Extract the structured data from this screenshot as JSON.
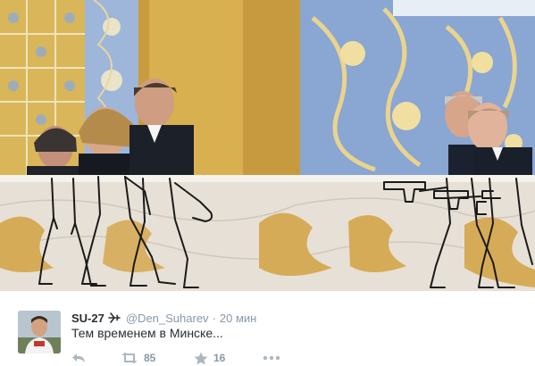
{
  "tweet": {
    "display_name": "SU-27",
    "handle": "@Den_Suharev",
    "separator": "·",
    "time": "20 мин",
    "text": "Тем временем в Минске...",
    "retweet_count": "85",
    "favorite_count": "16"
  },
  "icons": {
    "name_badge": "airplane-icon",
    "reply": "reply-icon",
    "retweet": "retweet-icon",
    "favorite": "star-icon",
    "more": "more-dots-icon"
  },
  "colors": {
    "name": "#292f33",
    "meta": "#8899a6",
    "icon": "#aab8c2",
    "photo_marble": "#e8e2d8",
    "photo_gold": "#d4a44a",
    "photo_blue": "#7d9cc8"
  }
}
